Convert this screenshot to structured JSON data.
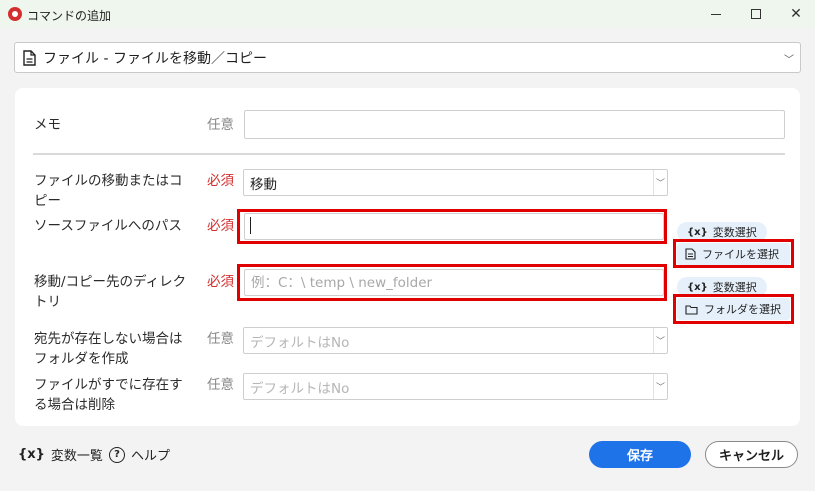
{
  "window": {
    "title": "コマンドの追加"
  },
  "command": {
    "selected": "ファイル - ファイルを移動／コピー"
  },
  "form": {
    "memo": {
      "label": "メモ",
      "badge": "任意",
      "value": ""
    },
    "operation": {
      "label_line1": "ファイルの移動またはコ",
      "label_line2": "ピー",
      "badge": "必須",
      "value": "移動"
    },
    "source_path": {
      "label": "ソースファイルへのパス",
      "badge": "必須",
      "value": ""
    },
    "dest_dir": {
      "label_line1": "移動/コピー先のディレク",
      "label_line2": "トリ",
      "badge": "必須",
      "placeholder": "例：C：\\ temp \\ new_folder"
    },
    "create_folder": {
      "label_line1": "宛先が存在しない場合は",
      "label_line2": "フォルダを作成",
      "badge": "任意",
      "value": "デフォルトはNo"
    },
    "delete_existing": {
      "label_line1": "ファイルがすでに存在す",
      "label_line2": "る場合は削除",
      "badge": "任意",
      "value": "デフォルトはNo"
    }
  },
  "pickers": {
    "var_select": "変数選択",
    "var_icon": "{x}",
    "file_select": "ファイルを選択",
    "folder_select": "フォルダを選択"
  },
  "footer": {
    "vars_icon": "{x}",
    "vars_list": "変数一覧",
    "help_icon": "?",
    "help": "ヘルプ",
    "save": "保存",
    "cancel": "キャンセル"
  },
  "colors": {
    "accent": "#1e73e8",
    "required": "#d32f2f",
    "highlight": "#e00000",
    "chip_bg": "#e6f0fb"
  }
}
